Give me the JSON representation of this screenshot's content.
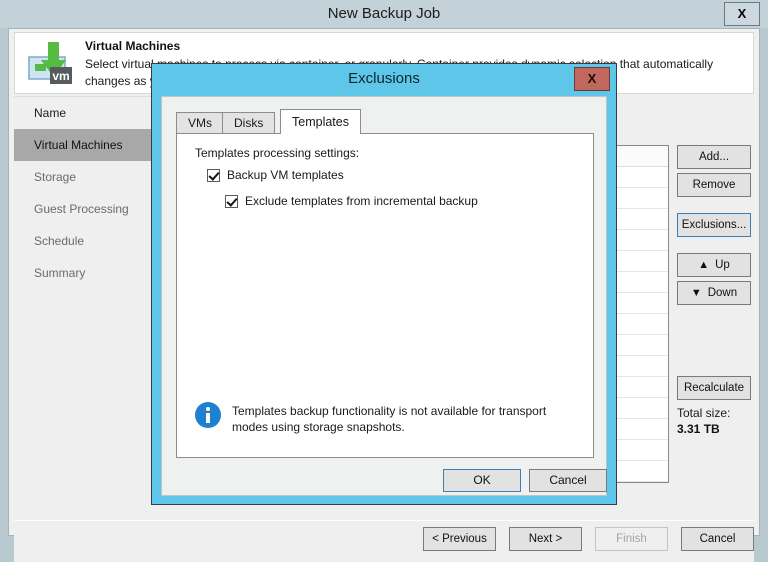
{
  "window": {
    "title": "New Backup Job",
    "close_label": "X",
    "header": {
      "title": "Virtual Machines",
      "description": "Select virtual machines to process via container, or granularly. Container provides dynamic selection that automatically changes as you add new VM into container.",
      "icon": "virtual-machine-icon"
    }
  },
  "sidebar": {
    "items": [
      {
        "label": "Name",
        "active": false
      },
      {
        "label": "Virtual Machines",
        "active": true
      },
      {
        "label": "Storage",
        "active": false
      },
      {
        "label": "Guest Processing",
        "active": false
      },
      {
        "label": "Schedule",
        "active": false
      },
      {
        "label": "Summary",
        "active": false
      }
    ]
  },
  "content": {
    "side_buttons": [
      {
        "label": "Add...",
        "name": "add-button"
      },
      {
        "label": "Remove",
        "name": "remove-button"
      },
      {
        "label": "Exclusions...",
        "name": "exclusions-button"
      },
      {
        "label": "Up",
        "name": "up-button",
        "icon": "arrow-up-icon"
      },
      {
        "label": "Down",
        "name": "down-button",
        "icon": "arrow-down-icon"
      },
      {
        "label": "Recalculate",
        "name": "recalculate-button"
      }
    ],
    "total_size_label": "Total size:",
    "total_size_value": "3.31 TB"
  },
  "footer": {
    "previous_label": "< Previous",
    "next_label": "Next >",
    "finish_label": "Finish",
    "cancel_label": "Cancel"
  },
  "dialog": {
    "title": "Exclusions",
    "close_label": "X",
    "tabs": [
      {
        "label": "VMs",
        "active": false
      },
      {
        "label": "Disks",
        "active": false
      },
      {
        "label": "Templates",
        "active": true
      }
    ],
    "panel": {
      "label": "Templates processing settings:",
      "checkboxes": [
        {
          "label": "Backup VM templates",
          "checked": true
        },
        {
          "label": "Exclude templates from incremental backup",
          "checked": true
        }
      ],
      "notice": {
        "icon": "info-icon",
        "text": "Templates backup functionality is not available for transport modes using storage snapshots."
      }
    },
    "ok_label": "OK",
    "cancel_label": "Cancel"
  },
  "colors": {
    "dialog_accent": "#5ec6e8",
    "close_red": "#c0675e",
    "info_blue": "#1f7fd0",
    "nav_active": "#a8a8a8",
    "window_chrome": "#c3d1d8"
  }
}
